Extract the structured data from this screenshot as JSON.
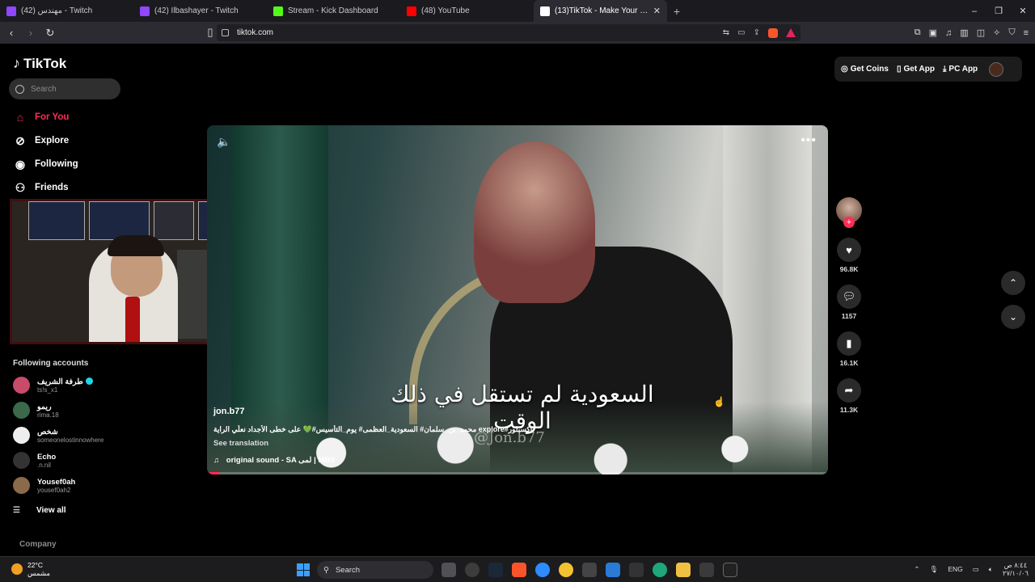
{
  "browser": {
    "tabs": [
      {
        "label": "(42) مهندس - Twitch",
        "color": "#9146ff",
        "active": false
      },
      {
        "label": "(42) Ilbashayer - Twitch",
        "color": "#9146ff",
        "active": false
      },
      {
        "label": "Stream - Kick Dashboard",
        "color": "#53fc18",
        "active": false
      },
      {
        "label": "(48) YouTube",
        "color": "#ff0000",
        "active": false
      },
      {
        "label": "(13)TikTok - Make Your Day",
        "color": "#ffffff",
        "active": true
      }
    ],
    "new_tab": "+",
    "url": "tiktok.com"
  },
  "tiktok": {
    "logo_text": "TikTok",
    "search_placeholder": "Search",
    "nav": [
      {
        "label": "For You",
        "icon": "home-icon",
        "glyph": "⌂"
      },
      {
        "label": "Explore",
        "icon": "compass-icon",
        "glyph": "⊘"
      },
      {
        "label": "Following",
        "icon": "following-avatar-icon",
        "glyph": "◉"
      },
      {
        "label": "Friends",
        "icon": "friends-icon",
        "glyph": "⚇"
      }
    ],
    "following_heading": "Following accounts",
    "accounts": [
      {
        "name": "طرفة الشريف",
        "handle": "ts!s_x1",
        "color": "#c84b6a",
        "verified": true
      },
      {
        "name": "ريمو",
        "handle": "rima.18",
        "color": "#3a6a4a",
        "verified": false
      },
      {
        "name": "شخص",
        "handle": "someonelostinnowhere",
        "color": "#eeeeee",
        "verified": false
      },
      {
        "name": "Echo",
        "handle": ".n.nil",
        "color": "#333333",
        "verified": false
      },
      {
        "name": "Yousef0ah",
        "handle": "yousef0ah2",
        "color": "#8a6a4a",
        "verified": false
      }
    ],
    "view_all": "View all",
    "company": "Company",
    "top_buttons": {
      "get_coins": "Get Coins",
      "get_app": "Get App",
      "pc_app": "PC App"
    }
  },
  "video": {
    "caption_arabic": "السعودية لم تستقل في ذلك الوقت",
    "watermark": "@Jon.b77",
    "author": "jon.b77",
    "description": "اكسبلور#explore محمد_بن_سلمان# السعودية_العظمى# يوم_التأسيس#💚 على خطى الأجداد نعلّي الراية",
    "see_translation": "See translation",
    "sound": "original sound - SA لمى | MBS",
    "progress": 0.02,
    "stats": {
      "likes": "96.8K",
      "comments": "1157",
      "saves": "16.1K",
      "shares": "11.3K"
    }
  },
  "taskbar": {
    "weather_temp": "22°C",
    "weather_desc": "مشمس",
    "search": "Search",
    "lang": "ENG",
    "time": "٨:٤٤ ص",
    "date": "٢٧/١٠/٠٦"
  }
}
